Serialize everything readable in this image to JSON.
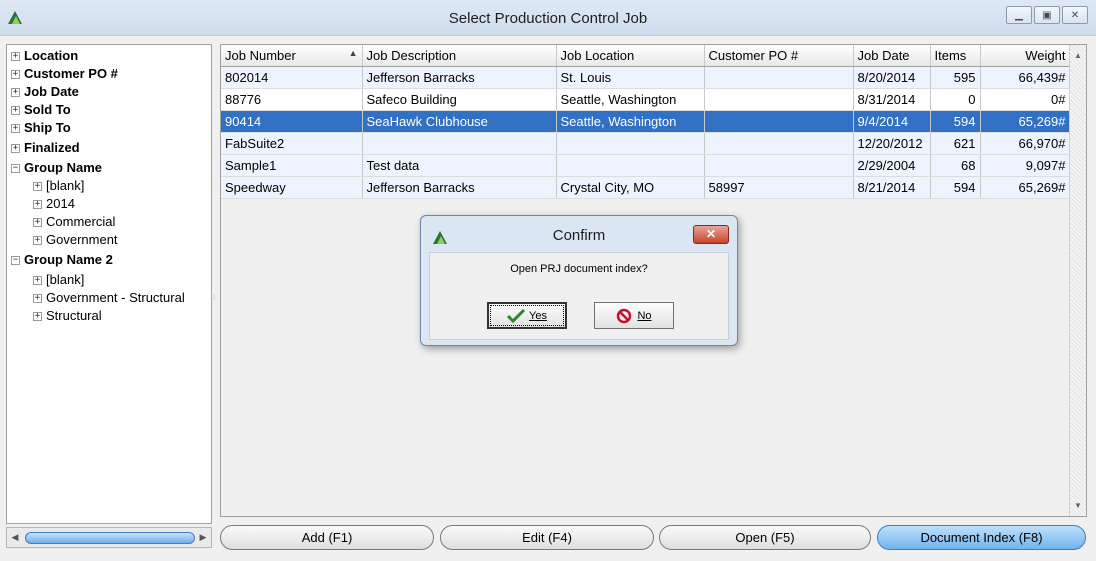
{
  "window": {
    "title": "Select Production Control Job",
    "icon": "app-logo-icon",
    "controls": [
      "minimize",
      "maximize",
      "close"
    ]
  },
  "tree": {
    "nodes": [
      {
        "label": "Location",
        "expanded": false,
        "bold": true,
        "level": 1
      },
      {
        "label": "Customer PO #",
        "expanded": false,
        "bold": true,
        "level": 1
      },
      {
        "label": "Job Date",
        "expanded": false,
        "bold": true,
        "level": 1
      },
      {
        "label": "Sold To",
        "expanded": false,
        "bold": true,
        "level": 1
      },
      {
        "label": "Ship To",
        "expanded": false,
        "bold": true,
        "level": 1
      },
      {
        "label": "Finalized",
        "expanded": false,
        "bold": true,
        "level": 1
      },
      {
        "label": "Group Name",
        "expanded": true,
        "bold": true,
        "level": 1
      },
      {
        "label": "[blank]",
        "expanded": false,
        "bold": false,
        "level": 2
      },
      {
        "label": "2014",
        "expanded": false,
        "bold": false,
        "level": 2
      },
      {
        "label": "Commercial",
        "expanded": false,
        "bold": false,
        "level": 2
      },
      {
        "label": "Government",
        "expanded": false,
        "bold": false,
        "level": 2
      },
      {
        "label": "Group Name 2",
        "expanded": true,
        "bold": true,
        "level": 1
      },
      {
        "label": "[blank]",
        "expanded": false,
        "bold": false,
        "level": 2
      },
      {
        "label": "Government - Structural",
        "expanded": false,
        "bold": false,
        "level": 2
      },
      {
        "label": "Structural",
        "expanded": false,
        "bold": false,
        "level": 2
      }
    ]
  },
  "grid": {
    "columns": [
      "Job Number",
      "Job Description",
      "Job Location",
      "Customer PO #",
      "Job Date",
      "Items",
      "Weight"
    ],
    "sorted_column": "Job Number",
    "rows": [
      [
        "802014",
        "Jefferson Barracks",
        "St. Louis",
        "",
        "8/20/2014",
        "595",
        "66,439#"
      ],
      [
        "88776",
        "Safeco Building",
        "Seattle, Washington",
        "",
        "8/31/2014",
        "0",
        "0#"
      ],
      [
        "90414",
        "SeaHawk Clubhouse",
        "Seattle, Washington",
        "",
        "9/4/2014",
        "594",
        "65,269#"
      ],
      [
        "FabSuite2",
        "",
        "",
        "",
        "12/20/2012",
        "621",
        "66,970#"
      ],
      [
        "Sample1",
        "Test data",
        "",
        "",
        "2/29/2004",
        "68",
        "9,097#"
      ],
      [
        "Speedway",
        "Jefferson Barracks",
        "Crystal City, MO",
        "58997",
        "8/21/2014",
        "594",
        "65,269#"
      ]
    ],
    "selected_row": 2
  },
  "buttons": {
    "add": "Add (F1)",
    "edit": "Edit (F4)",
    "open": "Open (F5)",
    "document_index": "Document Index (F8)"
  },
  "dialog": {
    "title": "Confirm",
    "message": "Open PRJ document index?",
    "yes_label": "Yes",
    "no_label": "No",
    "close_glyph": "✕",
    "yes_icon": "checkmark-icon",
    "no_icon": "prohibited-icon"
  },
  "colors": {
    "selection": "#3170c3",
    "active_button": "#6fb4ee",
    "title_bar": "#dfe9f5"
  }
}
